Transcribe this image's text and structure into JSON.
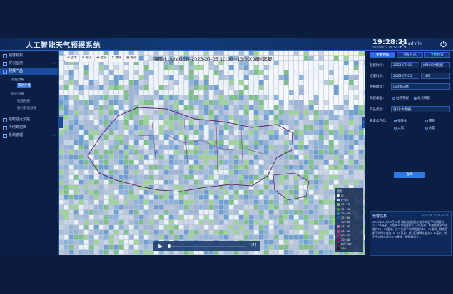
{
  "app": {
    "title": "人工智能天气预报系统",
    "time": "19:28:21",
    "date": "2023/09/27 19:28:21",
    "user": "admin"
  },
  "sidebar": {
    "items": [
      {
        "label": "预警预报"
      },
      {
        "label": "实况监测"
      },
      {
        "label": "预报产品"
      },
      {
        "label": "短时临近预报"
      },
      {
        "label": "个例数据库"
      },
      {
        "label": "系统管理"
      }
    ],
    "sub": {
      "group1": "短临预报",
      "active": "雷达外推",
      "group2": "短时预报",
      "item1": "短临预报",
      "item2": "短时数值预报"
    }
  },
  "map": {
    "toolbar": [
      "放大",
      "缩小",
      "漫游",
      "清除",
      "保存"
    ],
    "title": "强降水LightGBM-2023-07-05 10:00~13:00(08时起报)",
    "legend_title": "图例",
    "legend": [
      {
        "label": "无",
        "color": "#ffffff"
      },
      {
        "label": "0~10",
        "color": "#a6d8f5"
      },
      {
        "label": "10~15",
        "color": "#7fc97f"
      },
      {
        "label": "15~20",
        "color": "#3fa13f"
      },
      {
        "label": "20~25",
        "color": "#2c7fb8"
      },
      {
        "label": "25~30",
        "color": "#1f5fa8"
      },
      {
        "label": "30~40",
        "color": "#1d3f8f"
      },
      {
        "label": "40~50",
        "color": "#e46fb0"
      },
      {
        "label": "50~60",
        "color": "#c93b8a"
      },
      {
        "label": "60~70",
        "color": "#a4246b"
      },
      {
        "label": "70~80",
        "color": "#7a1550"
      },
      {
        "label": "80~100",
        "color": "#521035"
      },
      {
        "label": "100~",
        "color": "#330a20"
      }
    ],
    "player_count": "1/11"
  },
  "right": {
    "tabs": [
      "要素预报",
      "预报产品",
      "个例检索"
    ],
    "start_label": "起报时间：",
    "start_date": "2023-07-05",
    "start_hour": "8时(08时起报)",
    "end_label": "结束时间：",
    "end_date": "2023-07-05",
    "end_hour": "13时",
    "model_label": "预报模式：",
    "model_value": "LightGBM",
    "type_label": "预报类型：",
    "type_opt1": "站点预报",
    "type_opt2": "格点预报",
    "product_label": "产品类别：",
    "product_value": "逐3小时预报",
    "element_label": "要素类产品：",
    "el1": "强降水",
    "el2": "雷暴",
    "el3": "大风",
    "el4": "冰雹",
    "query": "查询",
    "news_title": "预警信息",
    "news_date": "2023-09-27 19:28:21",
    "news_body": "2023年07月05日12时 陕北北部(延安)部分地区平均雨量为15~28毫米，局部有平均雨量为37~34毫米；关中西部平均雨量为23~33毫米；关中东部平均降雨量为27~31毫米。陕南西部平均降水量为12~17毫米；部分区域降水量为5~8毫米；关中平均降水量为6~9毫米；降雨量较大。"
  }
}
